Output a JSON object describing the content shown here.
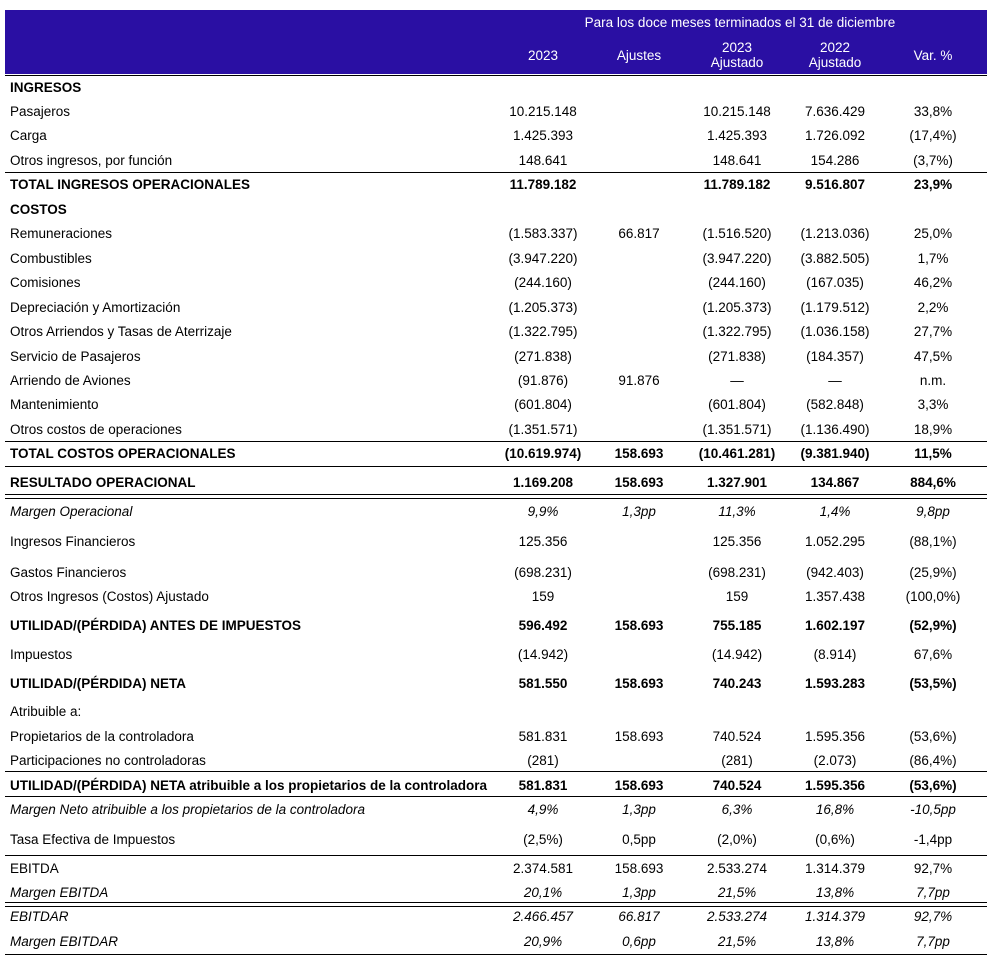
{
  "header": {
    "super_title": "Para los doce meses terminados el 31 de diciembre",
    "columns": [
      {
        "line1": "2023",
        "line2": ""
      },
      {
        "line1": "Ajustes",
        "line2": ""
      },
      {
        "line1": "2023",
        "line2": "Ajustado"
      },
      {
        "line1": "2022",
        "line2": "Ajustado"
      },
      {
        "line1": "Var. %",
        "line2": ""
      }
    ]
  },
  "rows": [
    {
      "label": "INGRESOS",
      "style": "bold",
      "values": [
        "",
        "",
        "",
        "",
        ""
      ]
    },
    {
      "label": "Pasajeros",
      "style": "",
      "values": [
        "10.215.148",
        "",
        "10.215.148",
        "7.636.429",
        "33,8%"
      ]
    },
    {
      "label": "Carga",
      "style": "",
      "values": [
        "1.425.393",
        "",
        "1.425.393",
        "1.726.092",
        "(17,4%)"
      ]
    },
    {
      "label": "Otros ingresos, por función",
      "style": "",
      "values": [
        "148.641",
        "",
        "148.641",
        "154.286",
        "(3,7%)"
      ]
    },
    {
      "label": "TOTAL INGRESOS OPERACIONALES",
      "style": "bold",
      "values": [
        "11.789.182",
        "",
        "11.789.182",
        "9.516.807",
        "23,9%"
      ]
    },
    {
      "label": "COSTOS",
      "style": "bold",
      "values": [
        "",
        "",
        "",
        "",
        ""
      ]
    },
    {
      "label": "Remuneraciones",
      "style": "",
      "values": [
        "(1.583.337)",
        "66.817",
        "(1.516.520)",
        "(1.213.036)",
        "25,0%"
      ]
    },
    {
      "label": "Combustibles",
      "style": "",
      "values": [
        "(3.947.220)",
        "",
        "(3.947.220)",
        "(3.882.505)",
        "1,7%"
      ]
    },
    {
      "label": "Comisiones",
      "style": "",
      "values": [
        "(244.160)",
        "",
        "(244.160)",
        "(167.035)",
        "46,2%"
      ]
    },
    {
      "label": "Depreciación y Amortización",
      "style": "",
      "values": [
        "(1.205.373)",
        "",
        "(1.205.373)",
        "(1.179.512)",
        "2,2%"
      ]
    },
    {
      "label": "Otros Arriendos y Tasas de Aterrizaje",
      "style": "",
      "values": [
        "(1.322.795)",
        "",
        "(1.322.795)",
        "(1.036.158)",
        "27,7%"
      ]
    },
    {
      "label": "Servicio de Pasajeros",
      "style": "",
      "values": [
        "(271.838)",
        "",
        "(271.838)",
        "(184.357)",
        "47,5%"
      ]
    },
    {
      "label": "Arriendo de Aviones",
      "style": "",
      "values": [
        "(91.876)",
        "91.876",
        "—",
        "—",
        "n.m."
      ]
    },
    {
      "label": "Mantenimiento",
      "style": "",
      "values": [
        "(601.804)",
        "",
        "(601.804)",
        "(582.848)",
        "3,3%"
      ]
    },
    {
      "label": "Otros costos de operaciones",
      "style": "",
      "values": [
        "(1.351.571)",
        "",
        "(1.351.571)",
        "(1.136.490)",
        "18,9%"
      ]
    },
    {
      "label": "TOTAL COSTOS OPERACIONALES",
      "style": "bold",
      "values": [
        "(10.619.974)",
        "158.693",
        "(10.461.281)",
        "(9.381.940)",
        "11,5%"
      ]
    },
    {
      "label": "RESULTADO OPERACIONAL",
      "style": "bold",
      "values": [
        "1.169.208",
        "158.693",
        "1.327.901",
        "134.867",
        "884,6%"
      ]
    },
    {
      "label": "Margen Operacional",
      "style": "italic",
      "values": [
        "9,9%",
        "1,3pp",
        "11,3%",
        "1,4%",
        "9,8pp"
      ]
    },
    {
      "label": "Ingresos Financieros",
      "style": "",
      "values": [
        "125.356",
        "",
        "125.356",
        "1.052.295",
        "(88,1%)"
      ]
    },
    {
      "label": "Gastos Financieros",
      "style": "",
      "values": [
        "(698.231)",
        "",
        "(698.231)",
        "(942.403)",
        "(25,9%)"
      ]
    },
    {
      "label": "Otros Ingresos (Costos) Ajustado",
      "style": "",
      "values": [
        "159",
        "",
        "159",
        "1.357.438",
        "(100,0%)"
      ]
    },
    {
      "label": "UTILIDAD/(PÉRDIDA) ANTES DE IMPUESTOS",
      "style": "bold",
      "values": [
        "596.492",
        "158.693",
        "755.185",
        "1.602.197",
        "(52,9%)"
      ]
    },
    {
      "label": "Impuestos",
      "style": "",
      "values": [
        "(14.942)",
        "",
        "(14.942)",
        "(8.914)",
        "67,6%"
      ]
    },
    {
      "label": "UTILIDAD/(PÉRDIDA) NETA",
      "style": "bold",
      "values": [
        "581.550",
        "158.693",
        "740.243",
        "1.593.283",
        "(53,5%)"
      ]
    },
    {
      "label": "Atribuible a:",
      "style": "",
      "values": [
        "",
        "",
        "",
        "",
        ""
      ]
    },
    {
      "label": "Propietarios de la controladora",
      "style": "",
      "values": [
        "581.831",
        "158.693",
        "740.524",
        "1.595.356",
        "(53,6%)"
      ]
    },
    {
      "label": "Participaciones no controladoras",
      "style": "",
      "values": [
        "(281)",
        "",
        "(281)",
        "(2.073)",
        "(86,4%)"
      ]
    },
    {
      "label": "UTILIDAD/(PÉRDIDA) NETA atribuible a los propietarios de la controladora",
      "style": "bold",
      "values": [
        "581.831",
        "158.693",
        "740.524",
        "1.595.356",
        "(53,6%)"
      ]
    },
    {
      "label": "Margen Neto atribuible a los propietarios de la controladora",
      "style": "italic",
      "values": [
        "4,9%",
        "1,3pp",
        "6,3%",
        "16,8%",
        "-10,5pp"
      ]
    },
    {
      "label": "Tasa Efectiva de Impuestos",
      "style": "",
      "values": [
        "(2,5%)",
        "0,5pp",
        "(2,0%)",
        "(0,6%)",
        "-1,4pp"
      ]
    },
    {
      "label": "EBITDA",
      "style": "",
      "values": [
        "2.374.581",
        "158.693",
        "2.533.274",
        "1.314.379",
        "92,7%"
      ]
    },
    {
      "label": "Margen EBITDA",
      "style": "italic",
      "values": [
        "20,1%",
        "1,3pp",
        "21,5%",
        "13,8%",
        "7,7pp"
      ]
    },
    {
      "label": "EBITDAR",
      "style": "italic",
      "values": [
        "2.466.457",
        "66.817",
        "2.533.274",
        "1.314.379",
        "92,7%"
      ]
    },
    {
      "label": "Margen EBITDAR",
      "style": "italic",
      "values": [
        "20,9%",
        "0,6pp",
        "21,5%",
        "13,8%",
        "7,7pp"
      ]
    }
  ]
}
